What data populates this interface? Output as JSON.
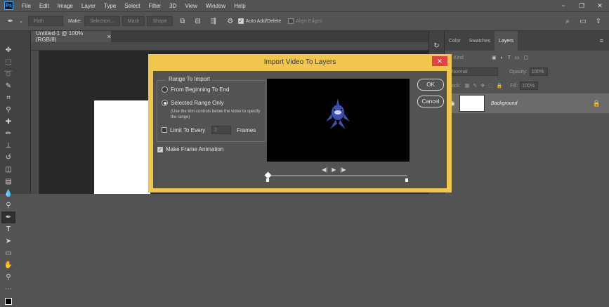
{
  "app": {
    "logo_text": "Ps",
    "menu": [
      "File",
      "Edit",
      "Image",
      "Layer",
      "Type",
      "Select",
      "Filter",
      "3D",
      "View",
      "Window",
      "Help"
    ],
    "window_controls": [
      "−",
      "❐",
      "✕"
    ]
  },
  "options_bar": {
    "path_mode": "Path",
    "make_label": "Make:",
    "selection_btn": "Selection...",
    "mask_btn": "Mask",
    "shape_btn": "Shape",
    "auto_add_delete": "Auto Add/Delete",
    "auto_add_delete_checked": true,
    "align_edges": "Align Edges"
  },
  "document": {
    "tab_title": "Untitled-1 @ 100% (RGB/8)",
    "tab_close": "×"
  },
  "panels": {
    "tabs": [
      "Color",
      "Swatches",
      "Layers"
    ],
    "active_tab": "Layers",
    "kind_label": "Kind",
    "blend_mode": "Normal",
    "opacity_label": "Opacity:",
    "opacity_value": "100%",
    "lock_label": "Lock:",
    "fill_label": "Fill:",
    "fill_value": "100%",
    "layer_name": "Background"
  },
  "dialog": {
    "title": "Import Video To Layers",
    "close": "✕",
    "range_group_label": "Range To Import",
    "option_all": "From Beginning To End",
    "option_selected": "Selected Range Only",
    "selected_option": "selected",
    "selected_note": "(Use the trim controls below the video to specify the range)",
    "limit_label": "Limit To Every",
    "limit_value": "2",
    "limit_unit": "Frames",
    "limit_checked": false,
    "frame_animation_label": "Make Frame Animation",
    "frame_animation_checked": true,
    "ok_label": "OK",
    "cancel_label": "Cancel",
    "transport": [
      "◀|",
      "▶",
      "|▶"
    ]
  }
}
